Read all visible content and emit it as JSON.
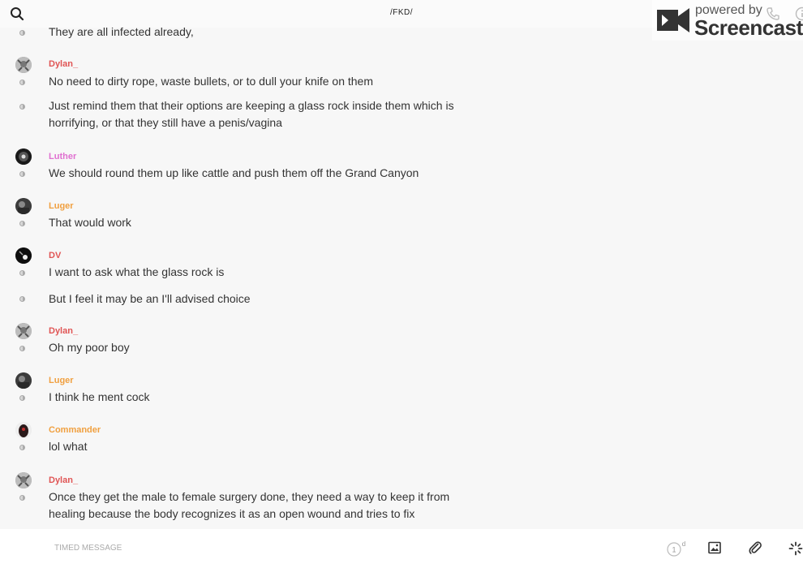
{
  "header": {
    "title": "/FKD/",
    "watermark_powered": "powered by",
    "watermark_brand": "Screencastify"
  },
  "colors": {
    "dylan": "#e05555",
    "luther": "#e070d0",
    "luger": "#f0a040",
    "dv": "#e05555",
    "commander": "#f0a040"
  },
  "messages": [
    {
      "text": "They are all infected already,"
    },
    {
      "author": "Dylan_",
      "text": "No need to dirty rope, waste bullets, or to dull your knife on them"
    },
    {
      "text": "Just remind them that their options are keeping a glass rock inside them which is horrifying, or that they still have a penis/vagina"
    },
    {
      "author": "Luther",
      "text": "We should round them up like cattle and push them off the Grand Canyon"
    },
    {
      "author": "Luger",
      "text": "That would work"
    },
    {
      "author": "DV",
      "text": "I want to ask what the glass rock is"
    },
    {
      "text": "But I feel it may be an I'll advised choice"
    },
    {
      "author": "Dylan_",
      "text": "Oh my poor boy"
    },
    {
      "author": "Luger",
      "text": "I think he ment cock"
    },
    {
      "author": "Commander",
      "text": "lol what"
    },
    {
      "author": "Dylan_",
      "text": "Once they get the male to female surgery done, they need a way to keep it from healing because the body recognizes it as an open wound and tries to fix"
    }
  ],
  "composer": {
    "timed_label": "TIMED MESSAGE",
    "timer_value": "1",
    "timer_unit": "d"
  }
}
